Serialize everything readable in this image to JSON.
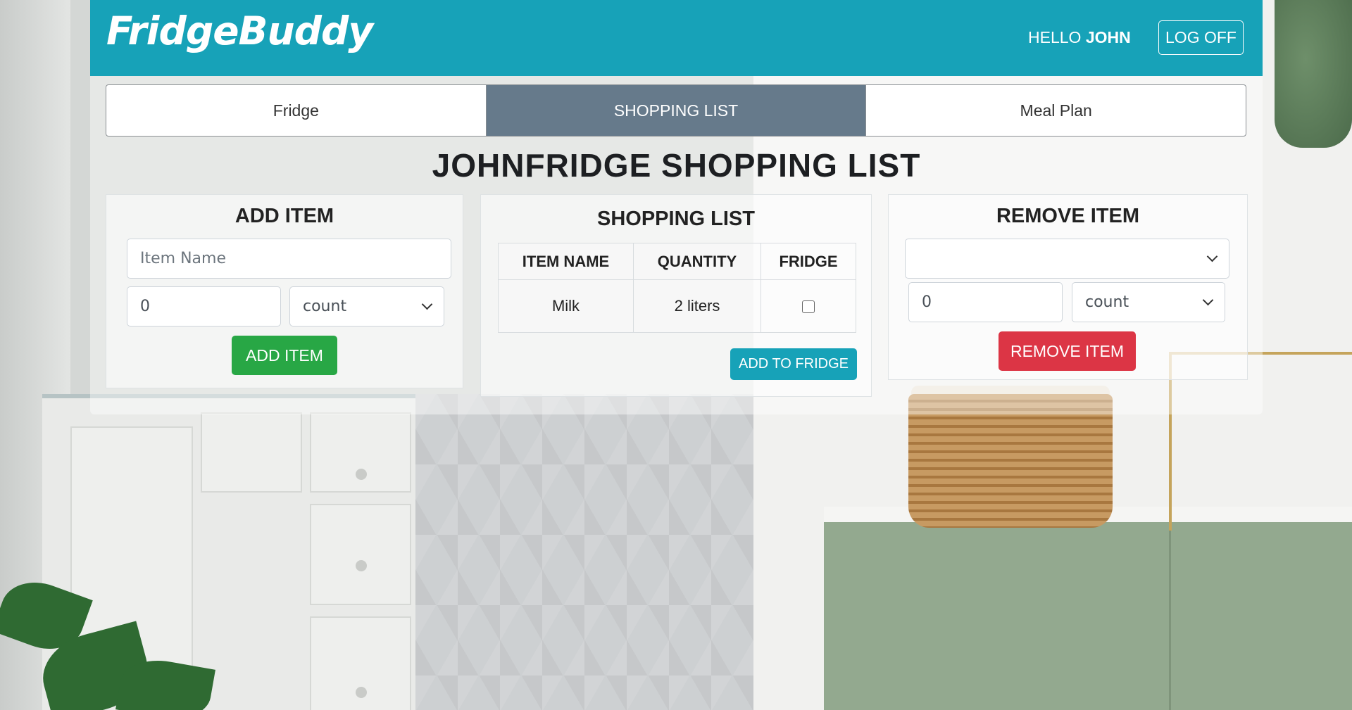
{
  "app": {
    "brand": "FridgeBuddy",
    "greeting_prefix": "HELLO",
    "user_name": "JOHN",
    "logoff_label": "LOG OFF"
  },
  "tabs": [
    {
      "label": "Fridge",
      "active": false
    },
    {
      "label": "SHOPPING LIST",
      "active": true
    },
    {
      "label": "Meal Plan",
      "active": false
    }
  ],
  "page_title": "JOHNFRIDGE SHOPPING LIST",
  "add_item": {
    "heading": "ADD ITEM",
    "name_placeholder": "Item Name",
    "quantity_value": "0",
    "unit_selected": "count",
    "button_label": "ADD ITEM"
  },
  "shopping_list": {
    "heading": "SHOPPING LIST",
    "columns": [
      "ITEM NAME",
      "QUANTITY",
      "FRIDGE"
    ],
    "rows": [
      {
        "item_name": "Milk",
        "quantity": "2 liters",
        "fridge_checked": false
      }
    ],
    "add_to_fridge_label": "ADD TO FRIDGE"
  },
  "remove_item": {
    "heading": "REMOVE ITEM",
    "item_selected": "",
    "quantity_value": "0",
    "unit_selected": "count",
    "button_label": "REMOVE ITEM"
  },
  "colors": {
    "navbar": "#17a2b8",
    "tab_active": "#667a8b",
    "add_button": "#28a745",
    "add_to_fridge_button": "#17a2b8",
    "remove_button": "#dc3545"
  }
}
